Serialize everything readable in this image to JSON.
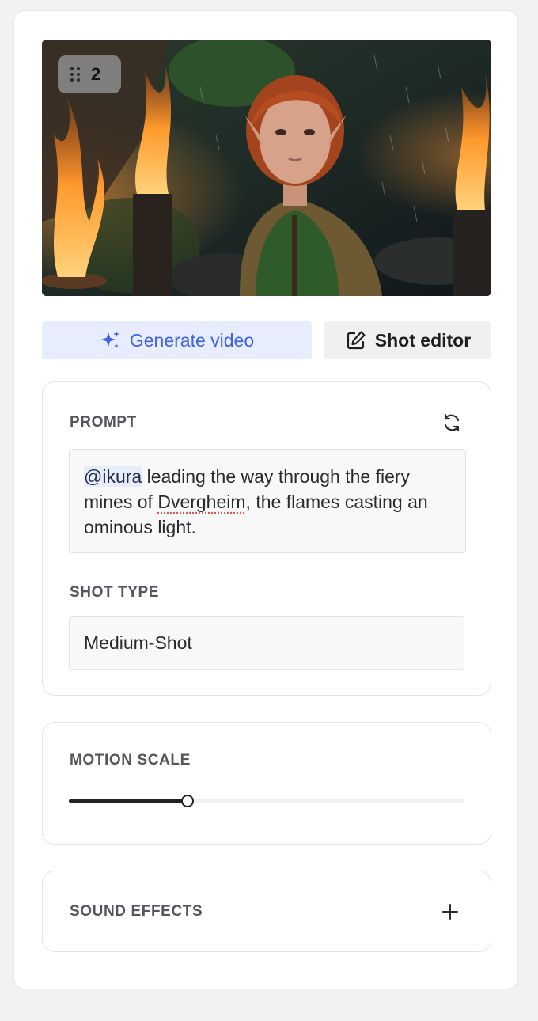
{
  "shot": {
    "number": "2"
  },
  "actions": {
    "generate_label": "Generate video",
    "editor_label": "Shot editor"
  },
  "prompt": {
    "label": "PROMPT",
    "mention": "@ikura",
    "text_before_misspelled": " leading the way through the fiery mines of ",
    "misspelled_word": "Dvergheim",
    "text_after_misspelled": ", the flames casting an ominous light."
  },
  "shot_type": {
    "label": "SHOT TYPE",
    "value": "Medium-Shot"
  },
  "motion_scale": {
    "label": "MOTION SCALE",
    "value": 0.3
  },
  "sound_effects": {
    "label": "SOUND EFFECTS"
  },
  "colors": {
    "accent": "#3d63e0",
    "accent_bg": "#e7edfc"
  }
}
